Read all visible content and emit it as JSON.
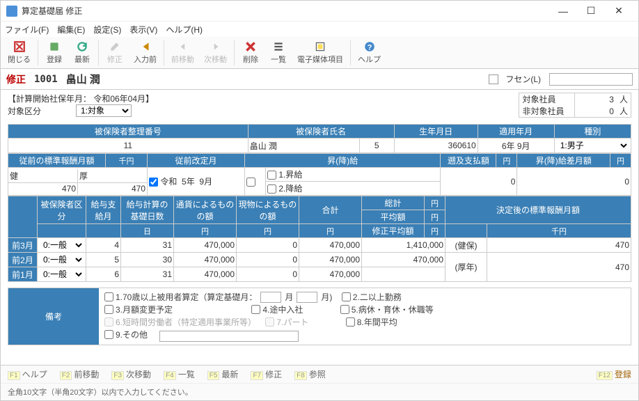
{
  "title": "算定基礎届 修正",
  "menu": {
    "file": "ファイル(F)",
    "edit": "編集(E)",
    "setting": "設定(S)",
    "view": "表示(V)",
    "help": "ヘルプ(H)"
  },
  "toolbar": {
    "close": "閉じる",
    "register": "登録",
    "refresh": "最新",
    "edit": "修正",
    "prev_input": "入力前",
    "prev_move": "前移動",
    "next_move": "次移動",
    "delete": "削除",
    "list": "一覧",
    "emedia": "電子媒体項目",
    "help": "ヘルプ"
  },
  "mode": "修正",
  "emp_id": "1001",
  "emp_name": "畠山 潤",
  "fusen_label": "フセン(L)",
  "calc_start": "【計算開始社保年月： 令和06年04月】",
  "counts": {
    "target_label": "対象社員",
    "target_val": "3",
    "target_unit": "人",
    "nontarget_label": "非対象社員",
    "nontarget_val": "0",
    "nontarget_unit": "人"
  },
  "target_div_label": "対象区分",
  "target_div_value": "1:対象",
  "t1": {
    "h_num": "被保険者整理番号",
    "h_name": "被保険者氏名",
    "h_birth": "生年月日",
    "h_apply": "適用年月",
    "h_type": "種別",
    "num": "11",
    "name": "畠山 潤",
    "seq": "5",
    "birth": "360610",
    "apply": "6年 9月",
    "type": "1:男子"
  },
  "t2": {
    "h_prev": "従前の標準報酬月額",
    "h_unit": "千円",
    "h_rev": "従前改定月",
    "h_upgdn": "昇(降)給",
    "h_retro": "遡及支払額",
    "h_yen": "円",
    "h_diff": "昇(降)給差月額",
    "ken": "健",
    "kou": "厚",
    "ken_val": "470",
    "kou_val": "470",
    "reiwa": "令和",
    "rev_y": "5年",
    "rev_m": "9月",
    "up": "1.昇給",
    "down": "2.降給",
    "retro": "0",
    "diff": "0"
  },
  "t3": {
    "h1": "被保険者区分",
    "h2": "給与支給月",
    "h3": "給与計算の基礎日数",
    "h4": "通貨によるものの額",
    "h5": "現物によるものの額",
    "h6": "合計",
    "h7": "総計",
    "h8": "決定後の標準報酬月額",
    "sub_day": "日",
    "sub_yen": "円",
    "sub_avg": "平均額",
    "sub_mod": "修正平均額",
    "sub_sen": "千円",
    "m3": "前3月",
    "m2": "前2月",
    "m1": "前1月",
    "div": "0:一般",
    "rows": [
      {
        "mon": "4",
        "days": "31",
        "cash": "470,000",
        "kind": "0",
        "total": "470,000"
      },
      {
        "mon": "5",
        "days": "30",
        "cash": "470,000",
        "kind": "0",
        "total": "470,000"
      },
      {
        "mon": "6",
        "days": "31",
        "cash": "470,000",
        "kind": "0",
        "total": "470,000"
      }
    ],
    "grand": "1,410,000",
    "avg": "470,000",
    "modavg": "",
    "kenpo": "(健保)",
    "kounen": "(厚年)",
    "kenpo_val": "470",
    "kounen_val": "470"
  },
  "bikou": {
    "label": "備考",
    "o1": "1.70歳以上被用者算定（算定基礎月：",
    "o1m1": "月",
    "o1m2": "月)",
    "o2": "2.二以上勤務",
    "o3": "3.月額変更予定",
    "o4": "4.途中入社",
    "o5": "5.病休・育休・休職等",
    "o6": "6.短時間労働者（特定適用事業所等）",
    "o7": "7.パート",
    "o8": "8.年間平均",
    "o9": "9.その他"
  },
  "status": {
    "help": "ヘルプ",
    "prev": "前移動",
    "next": "次移動",
    "list": "一覧",
    "refresh": "最新",
    "edit": "修正",
    "ref": "参照",
    "reg": "登録"
  },
  "hint": "全角10文字（半角20文字）以内で入力してください。",
  "winbtn": {
    "min": "—",
    "max": "☐",
    "close": "✕"
  }
}
